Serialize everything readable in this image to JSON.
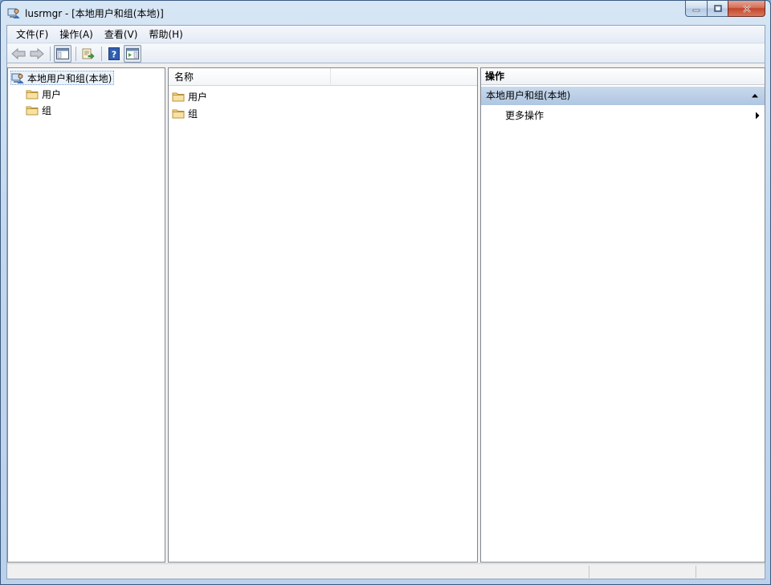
{
  "window": {
    "title": "lusrmgr - [本地用户和组(本地)]",
    "icon": "users-computer-icon"
  },
  "caption_buttons": [
    "minimize-icon",
    "maximize-icon",
    "close-icon"
  ],
  "menu": [
    {
      "label": "文件(F)"
    },
    {
      "label": "操作(A)"
    },
    {
      "label": "查看(V)"
    },
    {
      "label": "帮助(H)"
    }
  ],
  "toolbar": [
    "back-arrow-icon",
    "forward-arrow-icon",
    "show-hide-tree-icon",
    "export-list-icon",
    "help-icon",
    "show-hide-action-pane-icon"
  ],
  "tree": {
    "root": "本地用户和组(本地)",
    "children": [
      "用户",
      "组"
    ]
  },
  "list": {
    "columns": [
      "名称"
    ],
    "rows": [
      "用户",
      "组"
    ]
  },
  "actions": {
    "title": "操作",
    "group": "本地用户和组(本地)",
    "more": "更多操作"
  },
  "colors": {
    "folder": "#f3d78a",
    "selection": "#aec6e1"
  }
}
